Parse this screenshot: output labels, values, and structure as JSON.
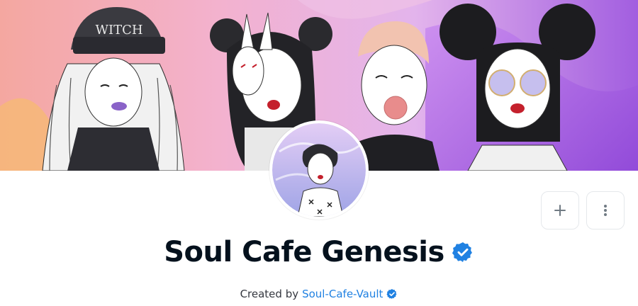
{
  "banner": {
    "hat_text": "WITCH",
    "colors": {
      "pink": "#f5a3b8",
      "lavender": "#e3b8ee",
      "purple": "#a860e0",
      "orange": "#f6b77a"
    }
  },
  "collection": {
    "title": "Soul Cafe Genesis",
    "verified": true,
    "created_by_prefix": "Created by",
    "creator_name": "Soul-Cafe-Vault",
    "creator_verified": true
  },
  "actions": {
    "add_icon": "plus-icon",
    "more_icon": "more-vertical-icon"
  },
  "colors": {
    "accent": "#2081e2",
    "verified_badge": "#2081e2",
    "title": "#04111d",
    "muted": "#353840",
    "border": "#e5e8eb"
  }
}
